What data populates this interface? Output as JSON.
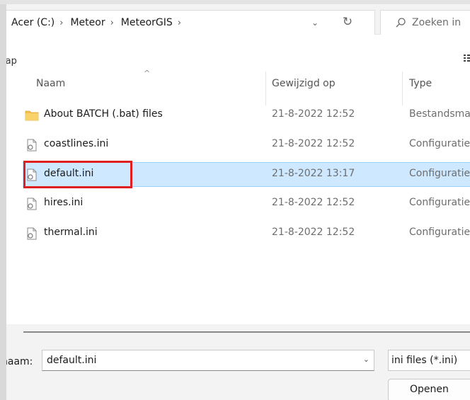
{
  "address": {
    "crumbs": [
      "Acer (C:)",
      "Meteor",
      "MeteorGIS"
    ],
    "separator": "›",
    "dropdown_glyph": "⌄",
    "refresh_glyph": "↻"
  },
  "search": {
    "placeholder": "Zoeken in",
    "icon": "search-icon"
  },
  "toolbar": {
    "label": "iap",
    "view_icon": "more-icon"
  },
  "columns": {
    "name": "Naam",
    "modified": "Gewijzigd op",
    "type": "Type",
    "sort_glyph": "^"
  },
  "files": [
    {
      "name": "About BATCH (.bat) files",
      "modified": "21-8-2022 12:52",
      "type": "Bestandsma",
      "icon": "folder-icon"
    },
    {
      "name": "coastlines.ini",
      "modified": "21-8-2022 12:52",
      "type": "Configuratie",
      "icon": "config-file-icon"
    },
    {
      "name": "default.ini",
      "modified": "21-8-2022 13:17",
      "type": "Configuratie",
      "icon": "config-file-icon",
      "selected": true
    },
    {
      "name": "hires.ini",
      "modified": "21-8-2022 12:52",
      "type": "Configuratie",
      "icon": "config-file-icon"
    },
    {
      "name": "thermal.ini",
      "modified": "21-8-2022 12:52",
      "type": "Configuratie",
      "icon": "config-file-icon"
    }
  ],
  "bottom": {
    "filename_label": "naam:",
    "filename_value": "default.ini",
    "filename_dropdown": "⌄",
    "filter_value": "ini files (*.ini)",
    "open_label": "Openen"
  },
  "colors": {
    "selection": "#cde8ff",
    "highlight": "#e02020",
    "folder": "#f4c04c"
  }
}
